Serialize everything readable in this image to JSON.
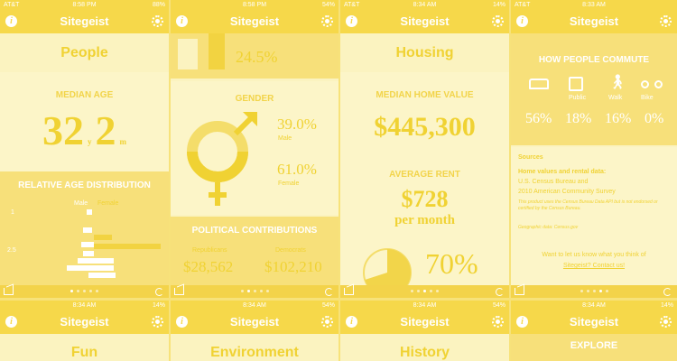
{
  "statusbar": {
    "p1": {
      "carrier": "AT&T",
      "time": "8:58 PM",
      "battery": "88%"
    },
    "p2": {
      "carrier": "",
      "time": "8:58 PM",
      "battery": "54%"
    },
    "p3": {
      "carrier": "AT&T",
      "time": "8:34 AM",
      "battery": "14%"
    },
    "p4": {
      "carrier": "AT&T",
      "time": "8:33 AM",
      "battery": ""
    },
    "p5": {
      "carrier": "",
      "time": "8:34 AM",
      "battery": "14%"
    },
    "p6": {
      "carrier": "",
      "time": "8:34 AM",
      "battery": "54%"
    },
    "p7": {
      "carrier": "",
      "time": "8:34 AM",
      "battery": "54%"
    },
    "p8": {
      "carrier": "",
      "time": "8:34 AM",
      "battery": "14%"
    }
  },
  "app_title": "Sitegeist",
  "people": {
    "heading": "People",
    "median_age_label": "MEDIAN AGE",
    "age_years": "32",
    "y_unit": "y",
    "age_months": "2",
    "m_unit": "m",
    "distribution_label": "RELATIVE AGE DISTRIBUTION",
    "legend_male": "Male",
    "legend_female": "Female",
    "axis_tick_1": "1",
    "axis_tick_2": "2.5"
  },
  "people2": {
    "top_pct": "24.5%",
    "top_label": "",
    "gender_label": "GENDER",
    "male_pct": "39.0%",
    "male_label": "Male",
    "female_pct": "61.0%",
    "female_label": "Female",
    "political_label": "POLITICAL CONTRIBUTIONS",
    "left_party": "Republicans",
    "right_party": "Democrats",
    "left_amount": "$28,562",
    "right_amount": "$102,210"
  },
  "housing": {
    "heading": "Housing",
    "home_value_label": "MEDIAN HOME VALUE",
    "home_value": "$445,300",
    "rent_label": "AVERAGE RENT",
    "rent_value": "$728",
    "rent_unit": "per month",
    "pie_pct": "70%",
    "pie_fraction": 0.7
  },
  "commute": {
    "label": "HOW PEOPLE COMMUTE",
    "modes": [
      "car-icon",
      "bus-icon",
      "walk-icon",
      "bike-icon"
    ],
    "mode_names": [
      "",
      "Public",
      "Walk",
      "Bike"
    ],
    "pcts": [
      "56%",
      "18%",
      "16%",
      "0%"
    ],
    "sources_heading": "Sources",
    "source_title": "Home values and rental data:",
    "source_line1": "U.S. Census Bureau and",
    "source_line2": "2010 American Community Survey",
    "disclaimer": "This product uses the Census Bureau Data API but is not endorsed or certified by the Census Bureau.",
    "credit": "Geographic data: Census.gov",
    "feedback_text": "Want to let us know what you think of",
    "feedback_link": "Sitegeist? Contact us!"
  },
  "bottom": {
    "fun": "Fun",
    "environment": "Environment",
    "history": "History",
    "explore": "EXPLORE",
    "explore_sub": ""
  }
}
